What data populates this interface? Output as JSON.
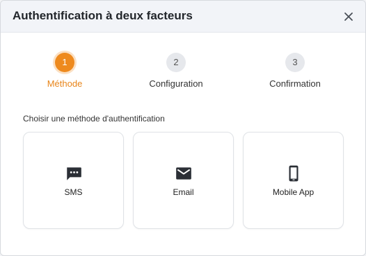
{
  "dialog": {
    "title": "Authentification à deux facteurs",
    "close_icon": "close-icon"
  },
  "steps": [
    {
      "number": "1",
      "label": "Méthode",
      "active": true
    },
    {
      "number": "2",
      "label": "Configuration",
      "active": false
    },
    {
      "number": "3",
      "label": "Confirmation",
      "active": false
    }
  ],
  "prompt": "Choisir une méthode d'authentification",
  "methods": [
    {
      "label": "SMS",
      "icon": "sms-icon"
    },
    {
      "label": "Email",
      "icon": "email-icon"
    },
    {
      "label": "Mobile App",
      "icon": "mobile-phone-icon"
    }
  ],
  "colors": {
    "accent": "#ee8a1e",
    "accent_text": "#e8851a",
    "icon": "#2b2f36"
  }
}
